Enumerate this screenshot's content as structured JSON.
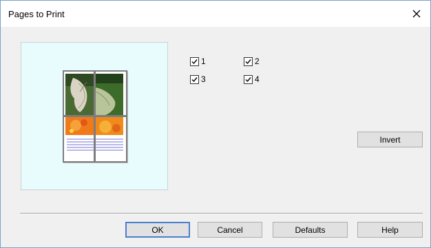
{
  "window": {
    "title": "Pages to Print",
    "close_icon": "close-icon"
  },
  "preview": {
    "pages": [
      "1",
      "2",
      "3",
      "4"
    ],
    "colors": {
      "background": "#e8fbfd",
      "orange": "#f07a1a",
      "green": "#3d6b2a"
    }
  },
  "checkboxes": [
    {
      "label": "1",
      "checked": true
    },
    {
      "label": "2",
      "checked": true
    },
    {
      "label": "3",
      "checked": true
    },
    {
      "label": "4",
      "checked": true
    }
  ],
  "buttons": {
    "invert": "Invert",
    "ok": "OK",
    "cancel": "Cancel",
    "defaults": "Defaults",
    "help": "Help"
  }
}
